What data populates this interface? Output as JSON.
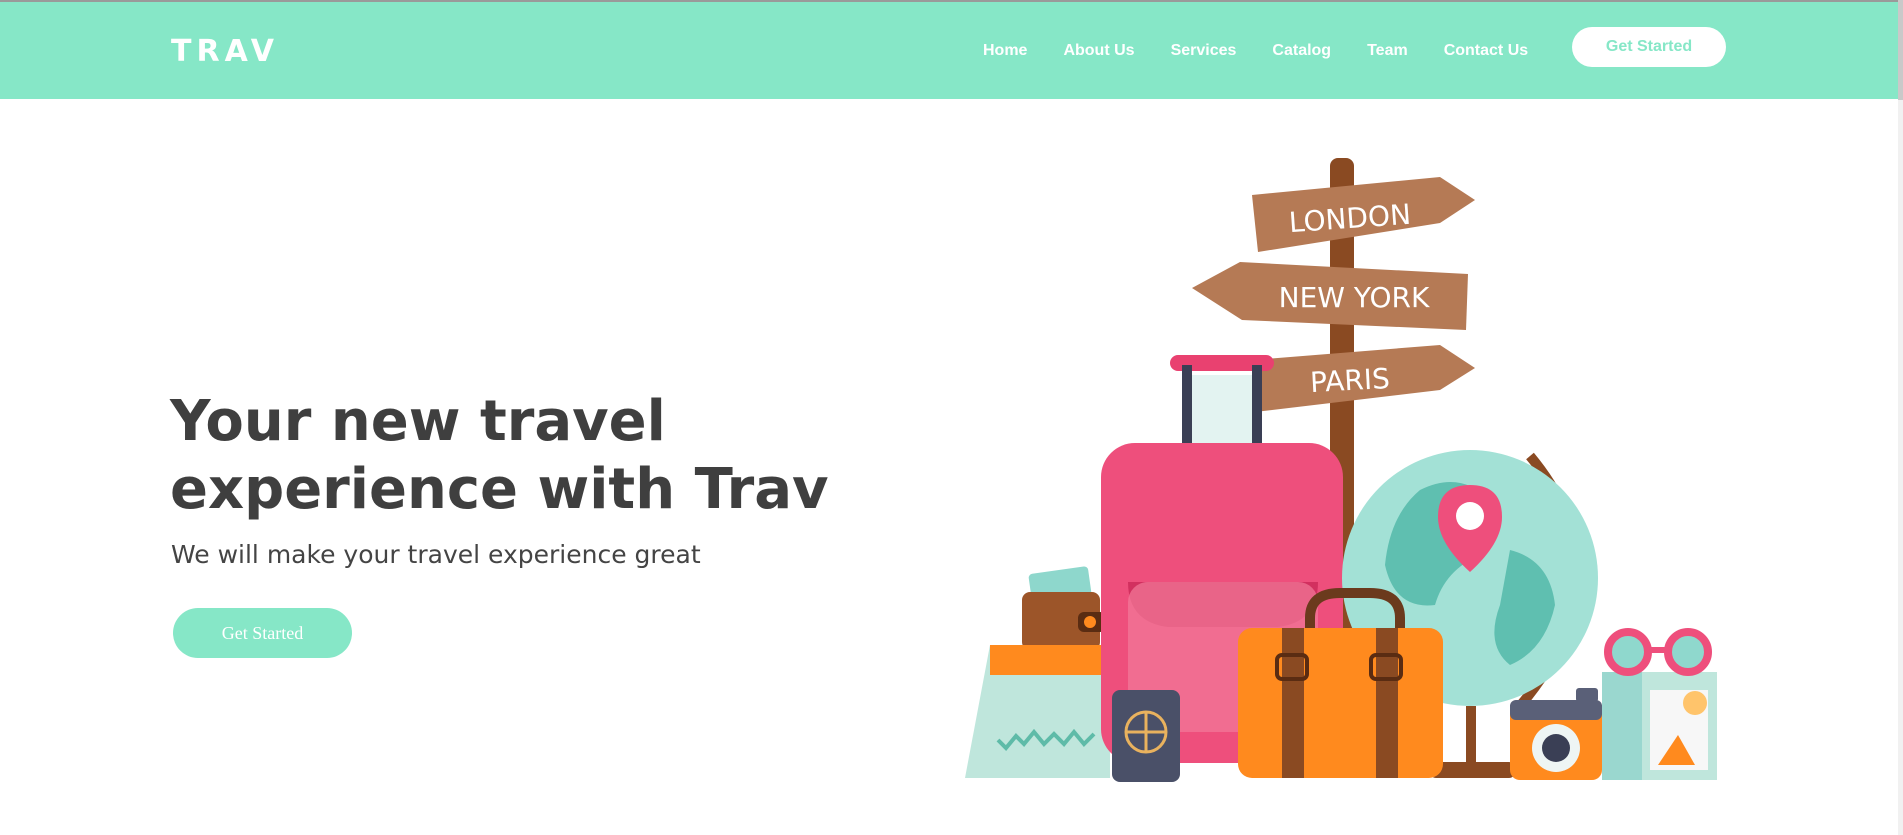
{
  "header": {
    "brand": "TRAV",
    "nav": [
      "Home",
      "About Us",
      "Services",
      "Catalog",
      "Team",
      "Contact Us"
    ],
    "cta_label": "Get Started"
  },
  "hero": {
    "title": "Your new travel experience with Trav",
    "subtitle": "We will make your travel experience great",
    "cta_label": "Get Started"
  },
  "illustration": {
    "signs": [
      "LONDON",
      "NEW YORK",
      "PARIS"
    ]
  },
  "colors": {
    "accent": "#86e7c7",
    "text_dark": "#3f3f3f",
    "white": "#ffffff"
  }
}
